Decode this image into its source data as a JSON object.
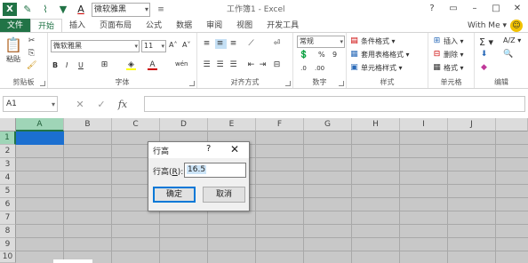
{
  "window": {
    "title": "工作簿1 - Excel",
    "controls": [
      "?",
      "▭",
      "–",
      "□",
      "✕"
    ]
  },
  "qat": {
    "font_value": "微软雅黑"
  },
  "tabs": [
    {
      "label": "文件"
    },
    {
      "label": "开始"
    },
    {
      "label": "插入"
    },
    {
      "label": "页面布局"
    },
    {
      "label": "公式"
    },
    {
      "label": "数据"
    },
    {
      "label": "审阅"
    },
    {
      "label": "视图"
    },
    {
      "label": "开发工具"
    }
  ],
  "user_label": "With Me ▾",
  "ribbon": {
    "clipboard": {
      "label": "剪贴板",
      "paste": "粘贴"
    },
    "font": {
      "label": "字体",
      "font_name": "微软雅黑",
      "font_size": "11",
      "bold": "B",
      "italic": "I",
      "underline": "U",
      "grow": "A˄",
      "shrink": "A˅",
      "phonetic": "wén"
    },
    "alignment": {
      "label": "对齐方式"
    },
    "number": {
      "label": "数字",
      "format": "常规",
      "percent": "%",
      "comma": "9"
    },
    "styles": {
      "label": "样式",
      "conditional": "条件格式 ▾",
      "table": "套用表格格式 ▾",
      "cell": "单元格样式 ▾"
    },
    "cells": {
      "label": "单元格",
      "insert": "插入 ▾",
      "delete": "删除 ▾",
      "format": "格式 ▾"
    },
    "editing": {
      "label": "编辑",
      "sum": "Σ ▾",
      "sort": "A/Z ▾"
    }
  },
  "formula_bar": {
    "name_box": "A1",
    "cancel": "✕",
    "enter": "✓",
    "fx": "fx",
    "value": ""
  },
  "grid": {
    "columns": [
      "A",
      "B",
      "C",
      "D",
      "E",
      "F",
      "G",
      "H",
      "I",
      "J"
    ],
    "rows": [
      "1",
      "2",
      "3",
      "4",
      "5",
      "6",
      "7",
      "8",
      "9",
      "10"
    ],
    "selected_cell": "A1"
  },
  "dialog": {
    "title": "行高",
    "help": "?",
    "close": "✕",
    "label_prefix": "行高(",
    "label_key": "R",
    "label_suffix": "):",
    "value": "16.5",
    "ok": "确定",
    "cancel": "取消"
  },
  "colors": {
    "accent": "#217346",
    "selection": "#1b6fd0"
  }
}
